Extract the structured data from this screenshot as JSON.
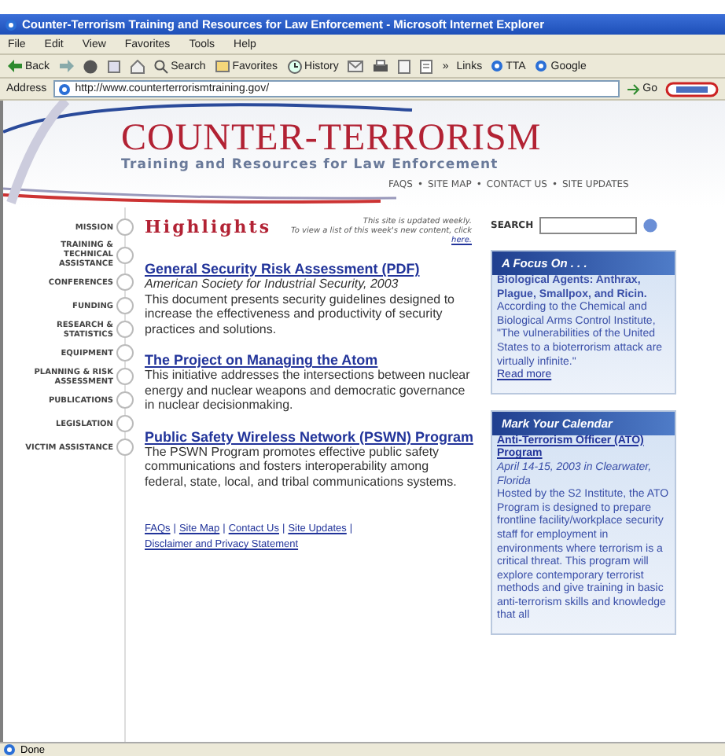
{
  "window": {
    "title": "Counter-Terrorism Training and Resources for Law Enforcement - Microsoft Internet Explorer"
  },
  "menu": [
    "File",
    "Edit",
    "View",
    "Favorites",
    "Tools",
    "Help"
  ],
  "toolbar": [
    {
      "kind": "back",
      "label": "Back"
    },
    {
      "kind": "forward"
    },
    {
      "kind": "stop"
    },
    {
      "kind": "refresh"
    },
    {
      "kind": "home"
    },
    {
      "kind": "search",
      "label": "Search"
    },
    {
      "kind": "favorites",
      "label": "Favorites"
    },
    {
      "kind": "history",
      "label": "History"
    },
    {
      "kind": "mail"
    },
    {
      "kind": "print"
    },
    {
      "kind": "edit"
    },
    {
      "kind": "discuss"
    }
  ],
  "links": {
    "chevron": "»",
    "label": "Links",
    "items": [
      "TTA",
      "Google"
    ]
  },
  "address": {
    "label": "Address",
    "value": "http://www.counterterrorismtraining.gov/",
    "go": "Go"
  },
  "site": {
    "title": "COUNTER-TERRORISM",
    "subtitle": "Training and Resources for Law Enforcement",
    "top_links": [
      "FAQS",
      "SITE MAP",
      "CONTACT US",
      "SITE UPDATES"
    ],
    "bullet": "•"
  },
  "nav": [
    "MISSION",
    "TRAINING & TECHNICAL ASSISTANCE",
    "CONFERENCES",
    "FUNDING",
    "RESEARCH & STATISTICS",
    "EQUIPMENT",
    "PLANNING & RISK ASSESSMENT",
    "PUBLICATIONS",
    "LEGISLATION",
    "VICTIM ASSISTANCE"
  ],
  "highlights": {
    "heading": "Highlights",
    "note": "This site is updated weekly.",
    "note2": "To view a list of this week's new content, click",
    "note_link": "here."
  },
  "articles": [
    {
      "title": "General Security Risk Assessment (PDF)",
      "source": "American Society for Industrial Security, 2003",
      "body": "This document presents security guidelines designed to increase the effectiveness and productivity of security practices and solutions."
    },
    {
      "title": "The Project on Managing the Atom",
      "body": "This initiative addresses the intersections between nuclear energy and nuclear weapons and democratic governance in nuclear decisionmaking."
    },
    {
      "title": "Public Safety Wireless Network (PSWN) Program",
      "body": "The PSWN Program promotes effective public safety communications and fosters interoperability among federal, state, local, and tribal communications systems."
    }
  ],
  "footer_links": [
    "FAQs",
    "Site Map",
    "Contact Us",
    "Site Updates",
    "Disclaimer and Privacy Statement"
  ],
  "footer_separator": "|",
  "search": {
    "label": "SEARCH"
  },
  "focus": {
    "heading": "A Focus On . . .",
    "lead": "Biological Agents: Anthrax, Plague, Smallpox, and Ricin.",
    "body": "According to the Chemical and Biological Arms Control Institute, \"The vulnerabilities of the United States to a bioterrorism attack are virtually infinite.\"",
    "link": "Read more"
  },
  "calendar": {
    "heading": "Mark Your Calendar",
    "title": "Anti-Terrorism Officer (ATO) Program",
    "date": "April 14-15, 2003 in Clearwater, Florida",
    "body": "Hosted by the S2 Institute, the ATO Program is designed to prepare frontline facility/workplace security staff for employment in environments where terrorism is a critical threat. This program will explore contemporary terrorist methods and give training in basic anti-terrorism skills and knowledge that all"
  },
  "status": "Done"
}
